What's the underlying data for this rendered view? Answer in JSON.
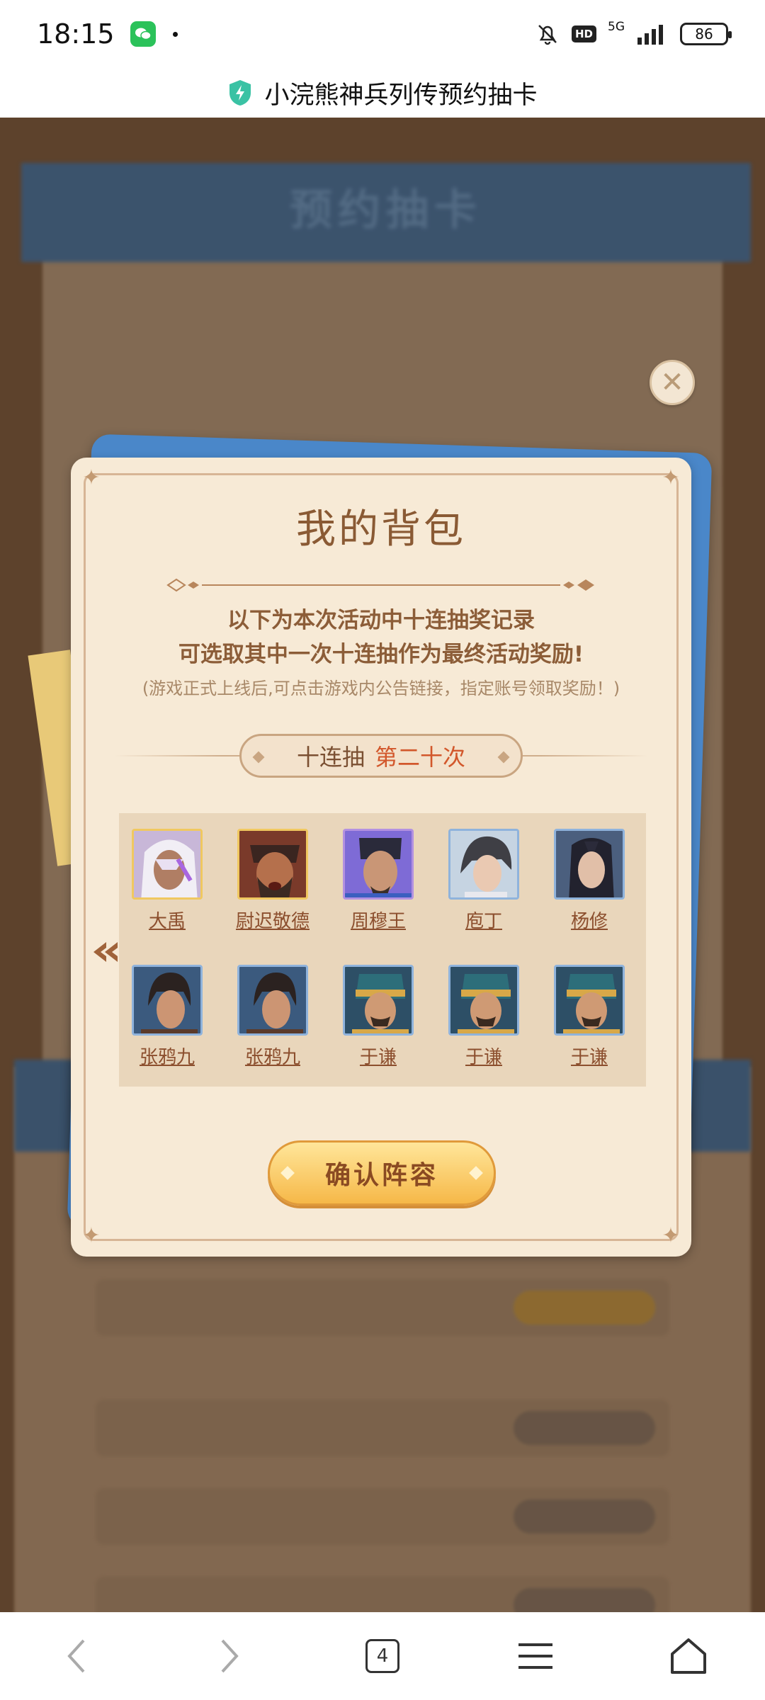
{
  "status_bar": {
    "time": "18:15",
    "hd_label": "HD",
    "network": "5G",
    "battery": "86"
  },
  "title_bar": {
    "title": "小浣熊神兵列传预约抽卡"
  },
  "background": {
    "banner_text": "预约抽卡"
  },
  "dialog": {
    "title": "我的背包",
    "description_line1": "以下为本次活动中十连抽奖记录",
    "description_line2": "可选取其中一次十连抽作为最终活动奖励!",
    "note": "(游戏正式上线后,可点击游戏内公告链接，指定账号领取奖励！)",
    "draw_label": "十连抽",
    "draw_number": "第二十次",
    "confirm_label": "确认阵容",
    "heroes": [
      {
        "name": "大禹",
        "frame": "gold"
      },
      {
        "name": "尉迟敬德",
        "frame": "gold"
      },
      {
        "name": "周穆王",
        "frame": "purple"
      },
      {
        "name": "庖丁",
        "frame": "blue"
      },
      {
        "name": "杨修",
        "frame": "blue"
      },
      {
        "name": "张鸦九",
        "frame": "blue"
      },
      {
        "name": "张鸦九",
        "frame": "blue"
      },
      {
        "name": "于谦",
        "frame": "blue"
      },
      {
        "name": "于谦",
        "frame": "blue"
      },
      {
        "name": "于谦",
        "frame": "blue"
      }
    ]
  },
  "nav_bar": {
    "tab_count": "4"
  },
  "colors": {
    "accent_brown": "#8c5d38",
    "highlight_orange": "#d2572b",
    "button_gold": "#f6b848",
    "card_blue": "#4a87c9"
  }
}
